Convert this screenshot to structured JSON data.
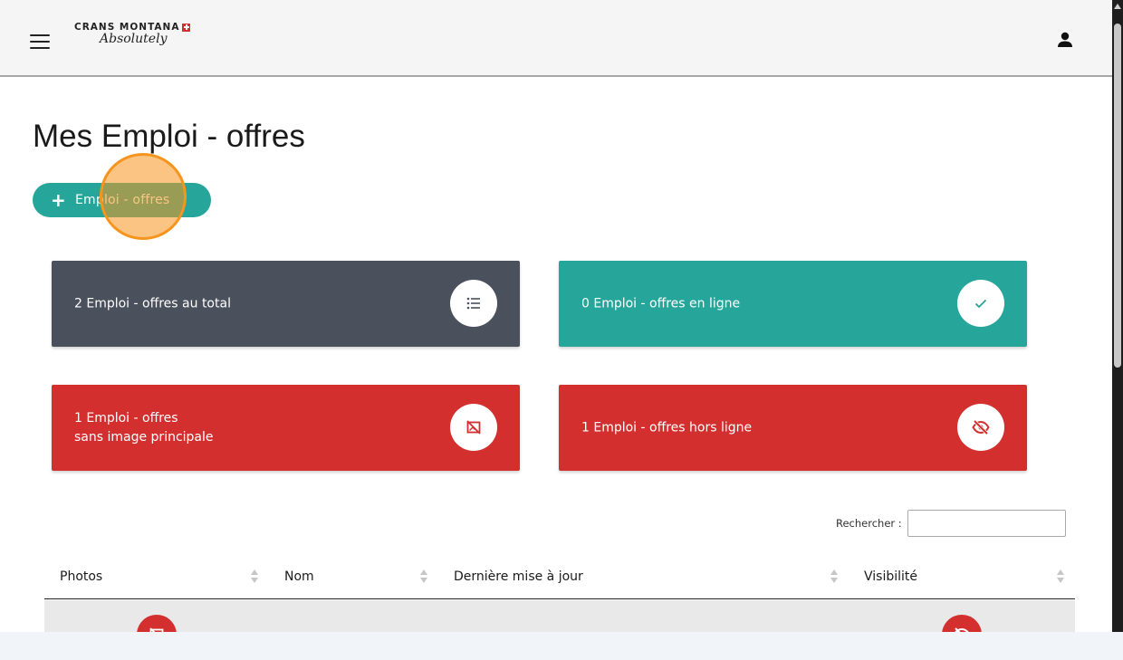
{
  "header": {
    "logo_top": "CRANS MONTANA",
    "logo_script": "Absolutely"
  },
  "page": {
    "title": "Mes Emploi - offres"
  },
  "toolbar": {
    "add_label": "Emploi - offres"
  },
  "cards": [
    {
      "label": "2 Emploi - offres au total",
      "icon": "list-icon",
      "color": "#4a505c"
    },
    {
      "label": "0 Emploi - offres en ligne",
      "icon": "check-icon",
      "color": "#26a69a"
    },
    {
      "label": "1 Emploi - offres\nsans image principale",
      "icon": "no-image-icon",
      "color": "#d32f2f"
    },
    {
      "label": "1 Emploi - offres hors ligne",
      "icon": "eye-off-icon",
      "color": "#d32f2f"
    }
  ],
  "search": {
    "label": "Rechercher :",
    "value": ""
  },
  "table": {
    "columns": [
      "Photos",
      "Nom",
      "Dernière mise à jour",
      "Visibilité"
    ],
    "rows": [
      {
        "photo_icon": "no-image-icon",
        "visibility_icon": "eye-off-icon"
      }
    ]
  },
  "colors": {
    "accent": "#26a69a",
    "danger": "#d32f2f",
    "dark": "#4a505c",
    "highlight": "#f7941d"
  }
}
